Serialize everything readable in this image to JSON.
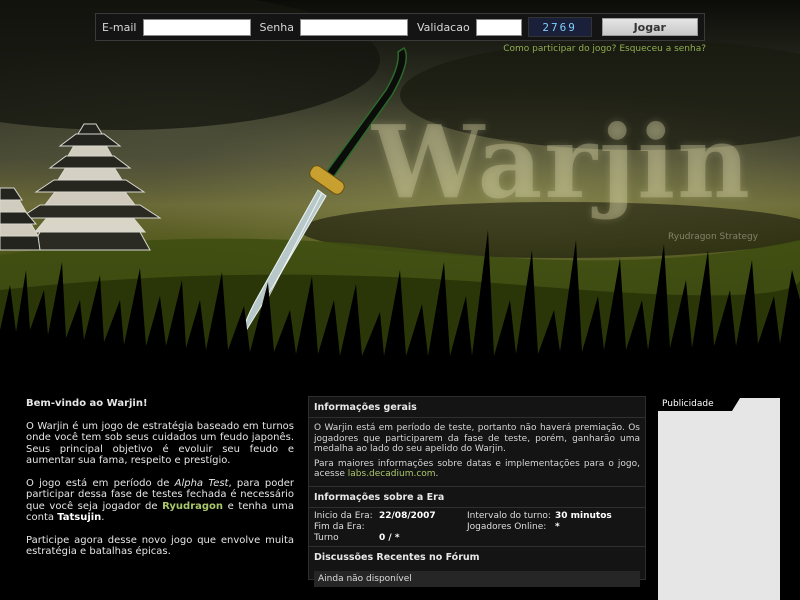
{
  "login": {
    "email_label": "E-mail",
    "email_value": "",
    "password_label": "Senha",
    "password_value": "",
    "validation_label": "Validacao",
    "validation_value": "",
    "captcha_text": "2769",
    "submit_label": "Jogar"
  },
  "help_links": {
    "how_to_join": "Como participar do jogo?",
    "forgot_password": "Esqueceu a senha?"
  },
  "banner": {
    "logo": "Warjin",
    "tagline": "Ryudragon Strategy"
  },
  "welcome": {
    "title": "Bem-vindo ao Warjin!",
    "p1": "O Warjin é um jogo de estratégia baseado em turnos onde você tem sob seus cuidados um feudo japonês. Seus principal objetivo é evoluir seu feudo e aumentar sua fama, respeito e prestígio.",
    "p2_a": "O jogo está em período de ",
    "p2_alpha": "Alpha Test",
    "p2_b": ", para poder participar dessa fase de testes fechada é necessário que você seja jogador de ",
    "p2_ryudragon": "Ryudragon",
    "p2_c": " e tenha uma conta ",
    "p2_tatsujin": "Tatsujin",
    "p2_d": ".",
    "p3": "Participe agora desse novo jogo que envolve muita estratégia e batalhas épicas."
  },
  "general_info": {
    "title": "Informações gerais",
    "p1": "O Warjin está em período de teste, portanto não haverá premiação. Os jogadores que participarem da fase de teste, porém, ganharão uma medalha ao lado do seu apelido do Warjin.",
    "p2_a": "Para maiores informações sobre datas e implementações para o jogo, acesse ",
    "p2_link": "labs.decadium.com",
    "p2_b": "."
  },
  "era": {
    "title": "Informações sobre a Era",
    "start_label": "Inicio da Era:",
    "start_value": "22/08/2007",
    "interval_label": "Intervalo do turno:",
    "interval_value": "30 minutos",
    "end_label": "Fim da Era:",
    "end_value": "",
    "online_label": "Jogadores Online:",
    "online_value": "*",
    "turn_label": "Turno",
    "turn_value": "0 / *"
  },
  "forum": {
    "title": "Discussões Recentes no Fórum",
    "empty": "Ainda não disponível"
  },
  "ad": {
    "label": "Publicidade"
  },
  "colors": {
    "accent_green": "#a9c86a",
    "link_green": "#8fae52",
    "panel_bg": "#141414"
  }
}
